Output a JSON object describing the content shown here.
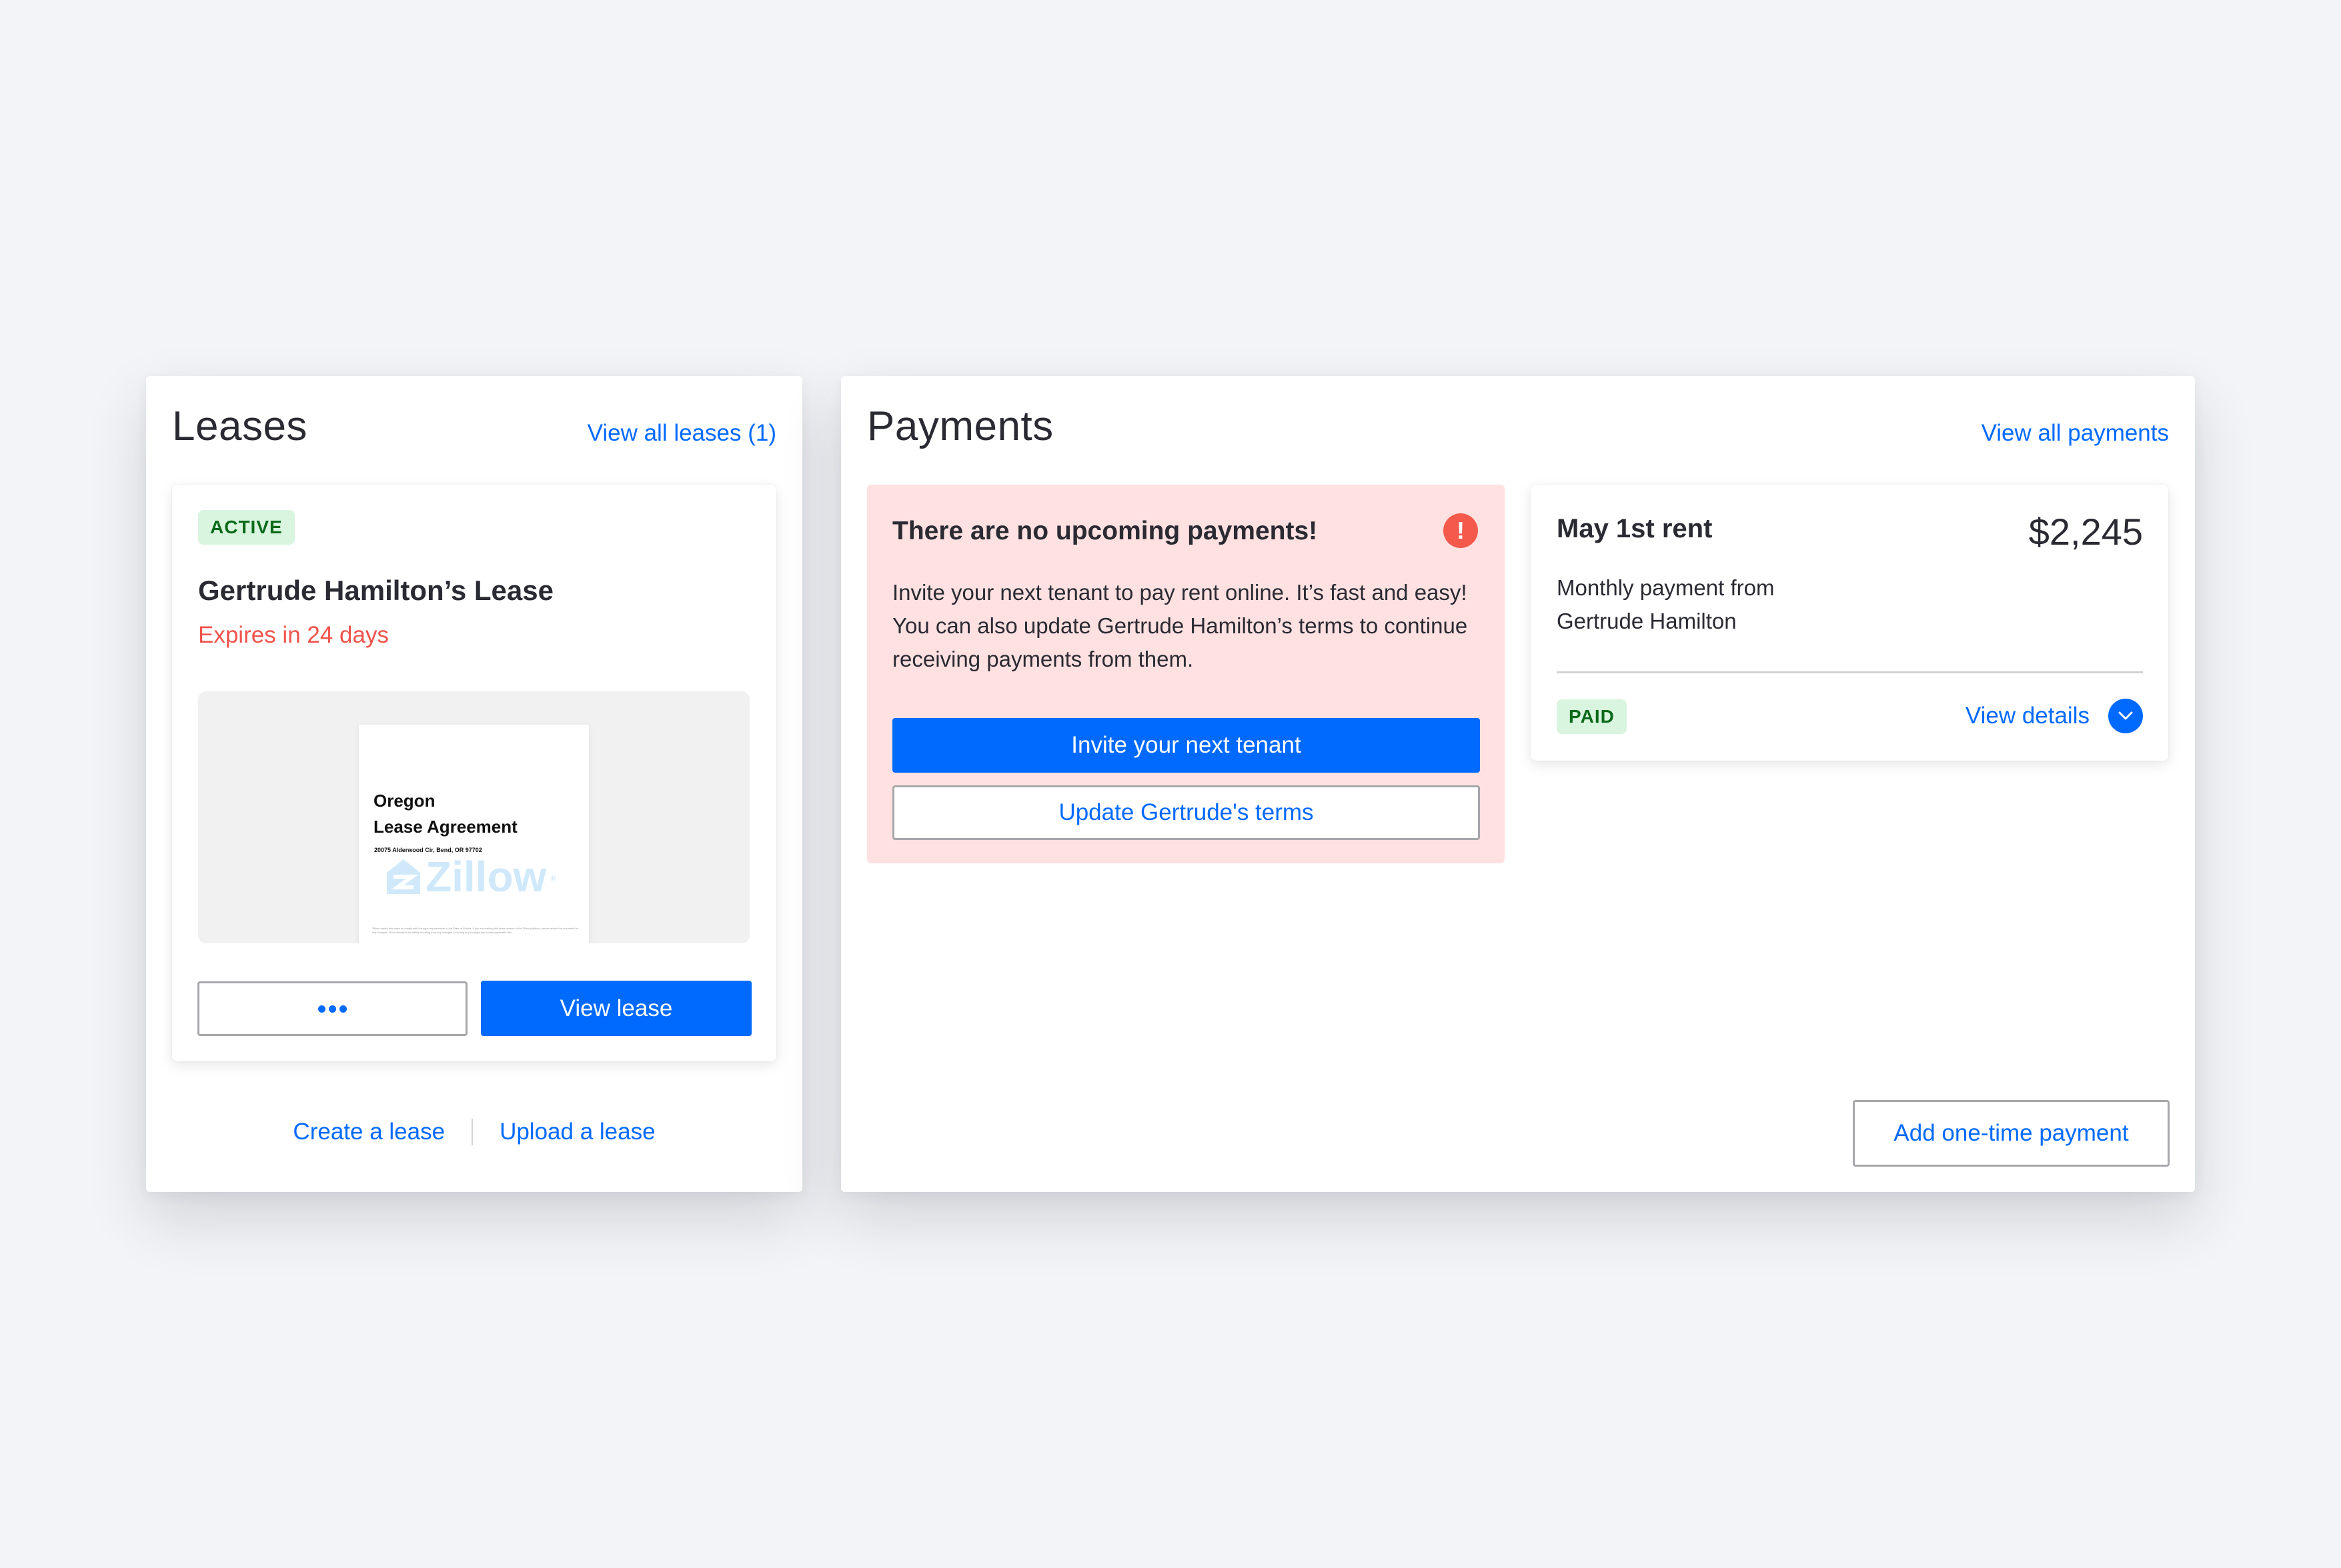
{
  "leases": {
    "title": "Leases",
    "view_all_link": "View all leases (1)",
    "card": {
      "status_badge": "ACTIVE",
      "lease_name": "Gertrude Hamilton’s Lease",
      "expires_text": "Expires in 24 days",
      "preview": {
        "doc_title_line1": "Oregon",
        "doc_title_line2": "Lease Agreement",
        "doc_address": "20075 Alderwood Cir, Bend, OR 97702",
        "watermark": "Zillow",
        "watermark_registered": "®",
        "fineprint": "Zillow drafted this lease to comply with the legal requirements of the State of Florida. If you are reading this lease outside of the Zillow platform, please review the document for any changes. Zillow disclaims all liability resulting from any changes, including any changes that violate applicable law."
      },
      "more_button_icon": "more-dots-icon",
      "view_lease_button": "View lease"
    },
    "footer_links": {
      "create": "Create a lease",
      "upload": "Upload a lease"
    }
  },
  "payments": {
    "title": "Payments",
    "view_all_link": "View all payments",
    "alert": {
      "title": "There are no upcoming payments!",
      "icon": "exclamation-icon",
      "icon_glyph": "!",
      "body": "Invite your next tenant to pay rent online. It’s fast and easy! You can also update Gertrude Hamilton’s terms to continue receiving payments from them.",
      "invite_button": "Invite your next tenant",
      "update_button": "Update Gertrude's terms"
    },
    "rent_card": {
      "title": "May 1st rent",
      "amount": "$2,245",
      "description_line1": "Monthly payment from",
      "description_line2": "Gertrude Hamilton",
      "status_badge": "PAID",
      "view_details_link": "View details",
      "expand_icon": "chevron-down-icon"
    },
    "add_payment_button": "Add one-time payment"
  },
  "colors": {
    "accent": "#006aff",
    "page_background": "#f3f4f7",
    "alert_background": "#ffe1e1",
    "alert_icon": "#f4594c",
    "expires_text": "#f0534a",
    "badge_background": "#d9f4df",
    "badge_text": "#0a6a1a"
  }
}
